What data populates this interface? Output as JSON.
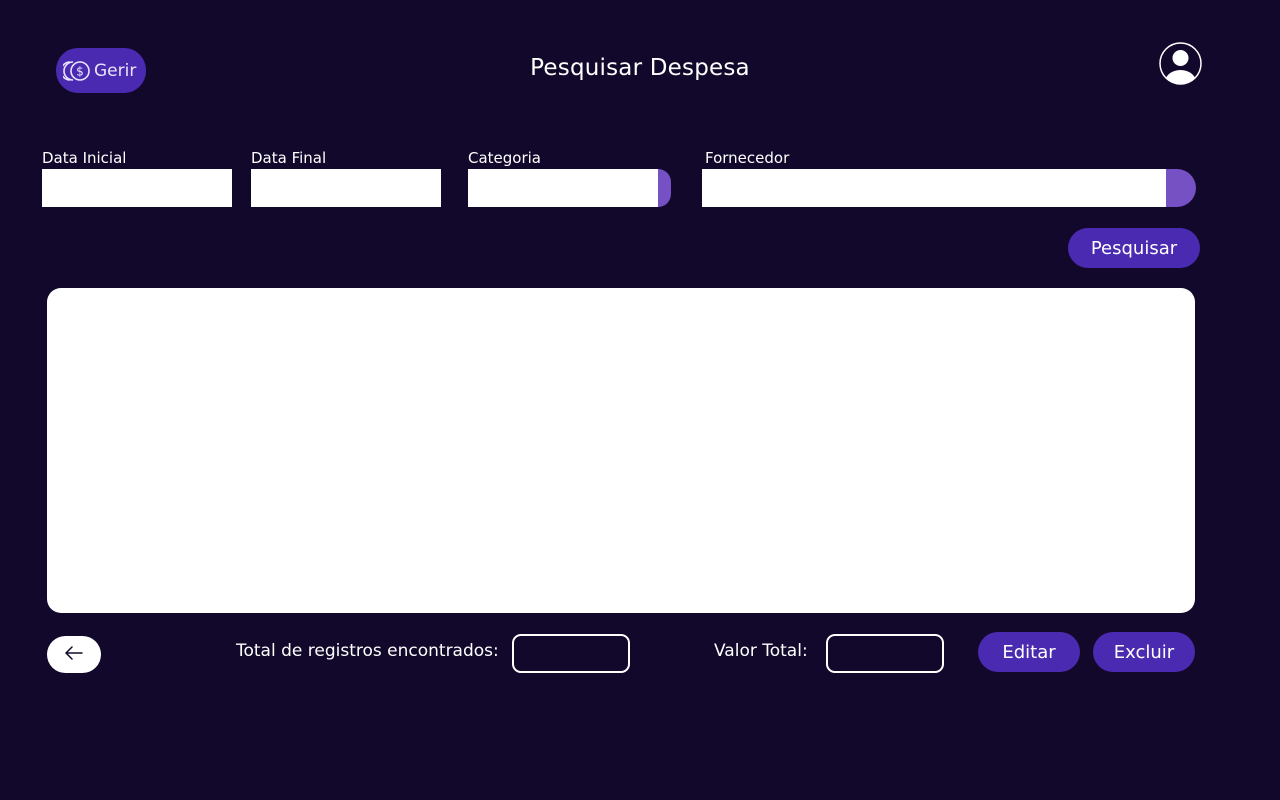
{
  "header": {
    "logo_text": "Gerir",
    "title": "Pesquisar Despesa"
  },
  "filters": {
    "data_inicial": {
      "label": "Data Inicial",
      "value": ""
    },
    "data_final": {
      "label": "Data Final",
      "value": ""
    },
    "categoria": {
      "label": "Categoria",
      "value": ""
    },
    "fornecedor": {
      "label": "Fornecedor",
      "value": ""
    }
  },
  "actions": {
    "search_label": "Pesquisar",
    "edit_label": "Editar",
    "delete_label": "Excluir"
  },
  "footer": {
    "total_records_label": "Total de registros encontrados:",
    "total_records_value": "",
    "total_value_label": "Valor Total:",
    "total_value_value": ""
  },
  "icons": {
    "logo": "coins-icon",
    "avatar": "user-icon",
    "back": "arrow-left-icon"
  },
  "colors": {
    "background": "#12082b",
    "primary": "#4a2ab0",
    "field_button": "#7651c4",
    "panel": "#ffffff"
  }
}
